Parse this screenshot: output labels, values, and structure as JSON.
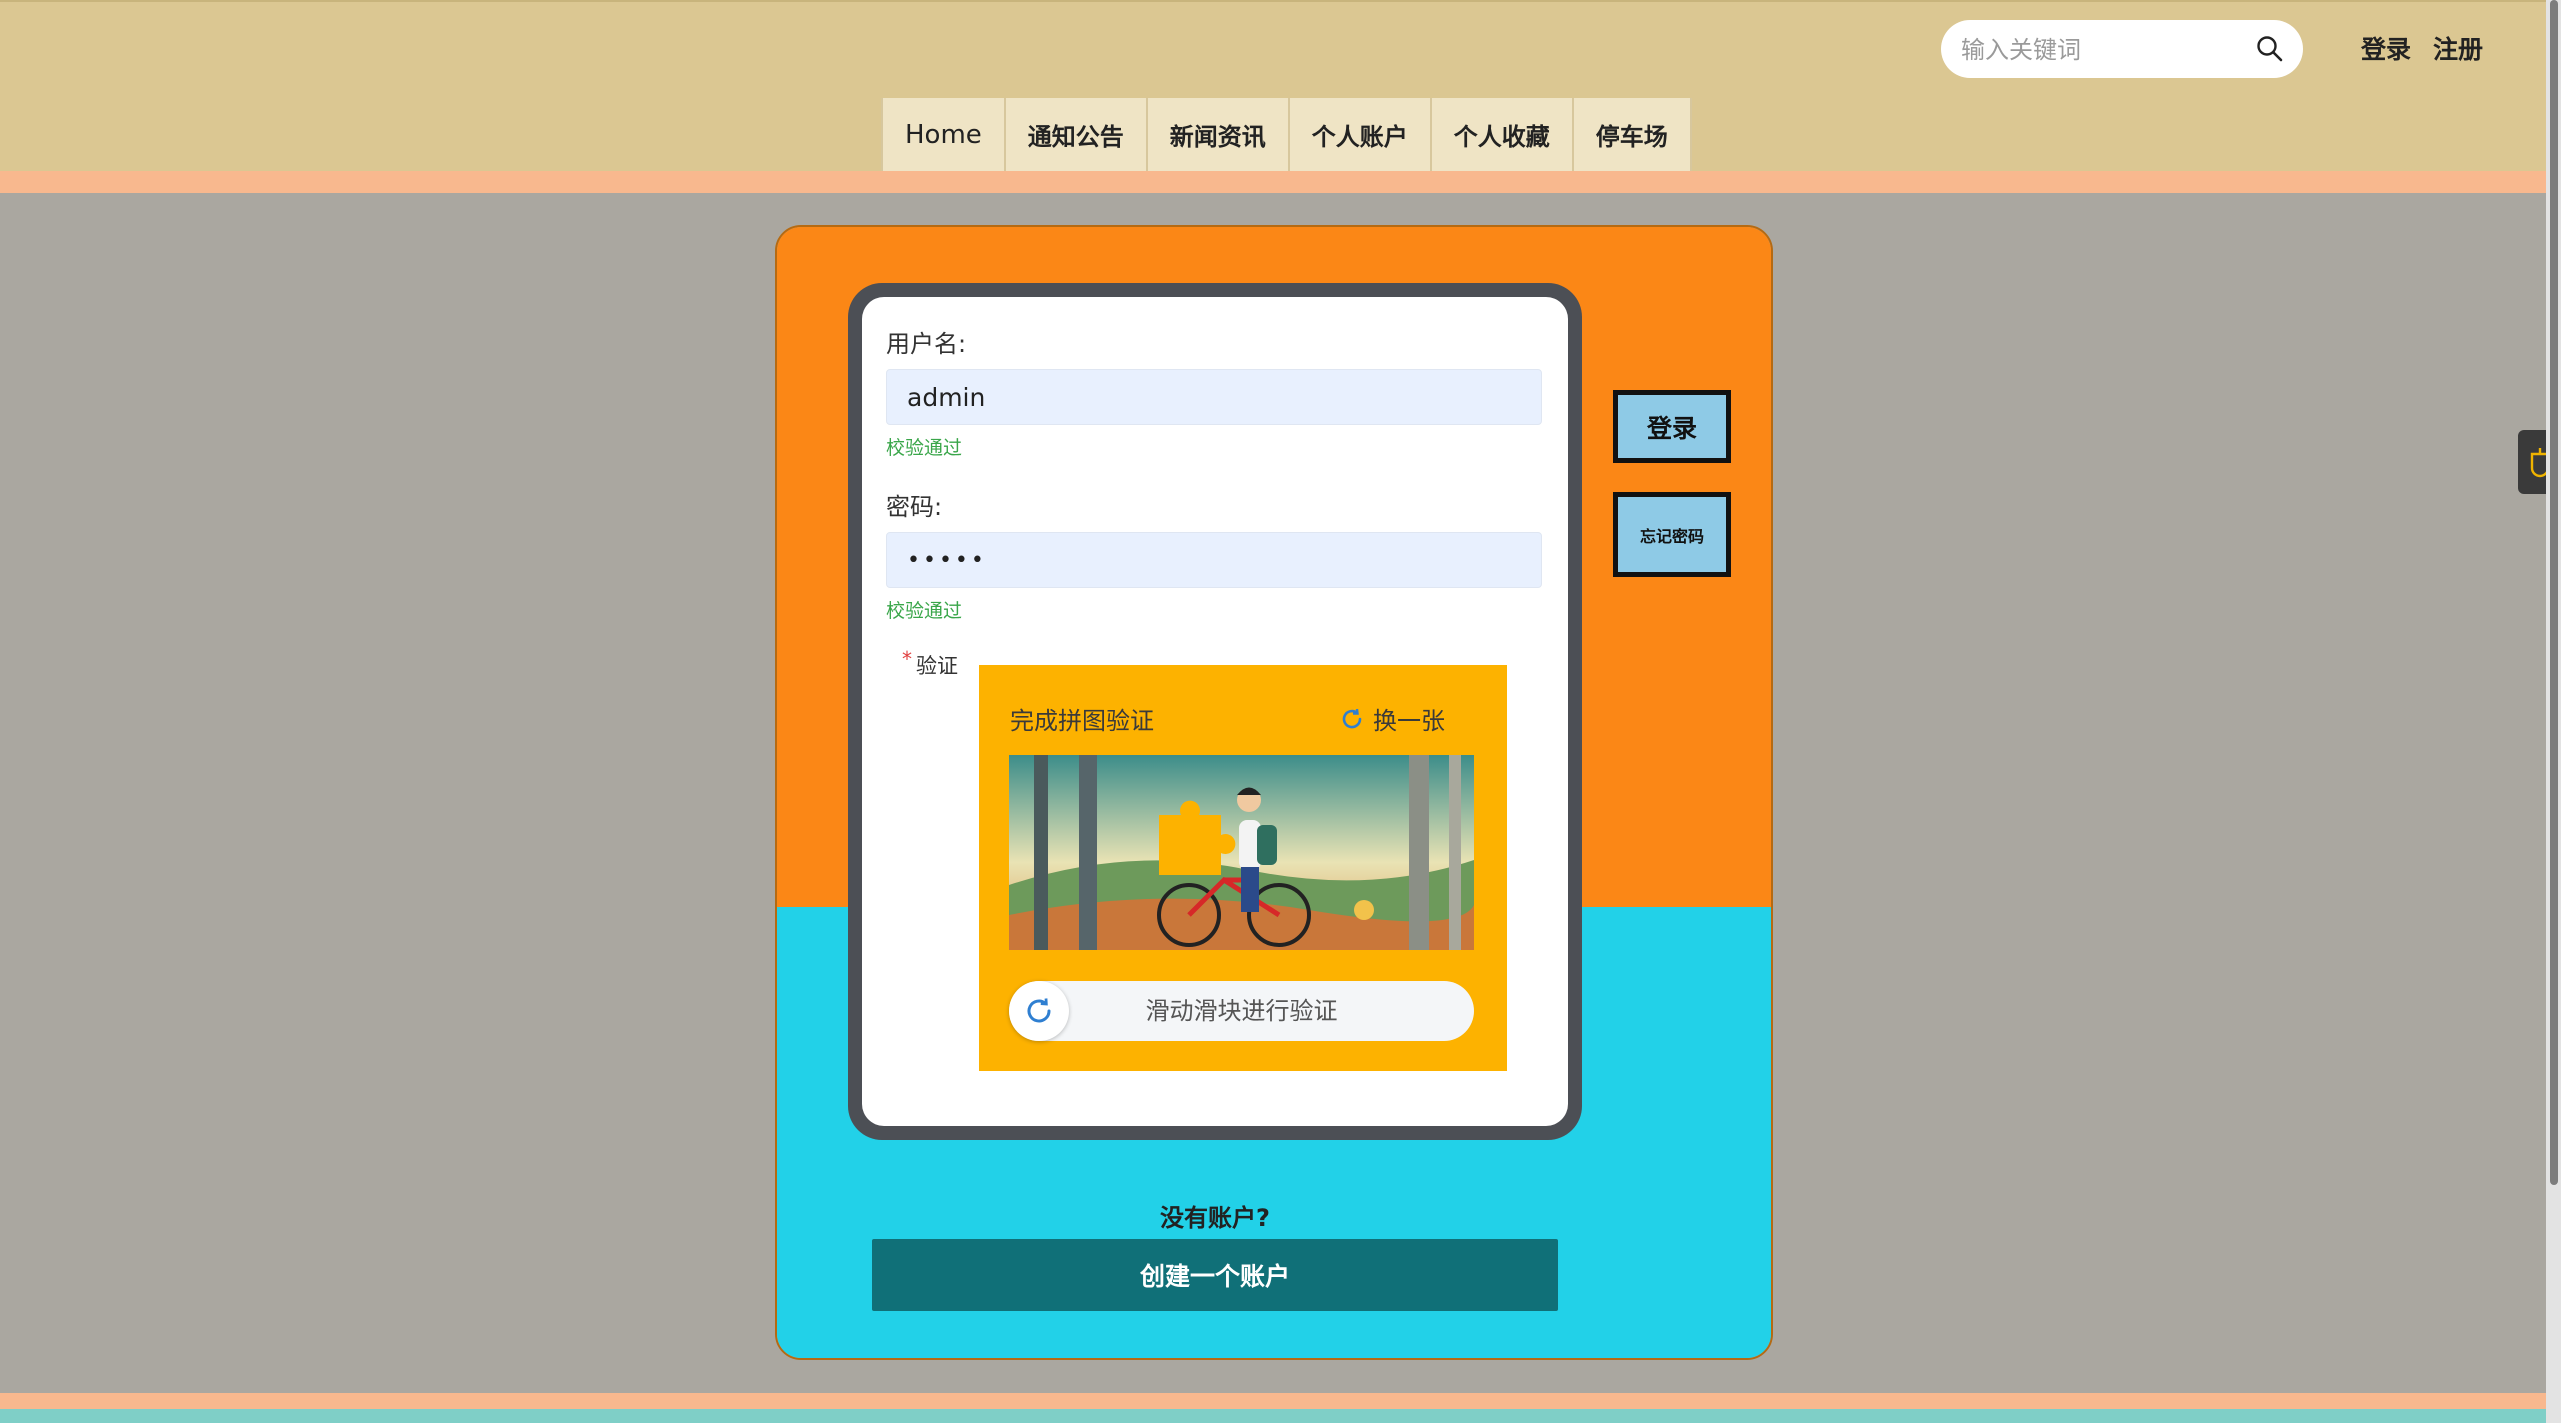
{
  "header": {
    "search_placeholder": "输入关键词",
    "login_link": "登录",
    "register_link": "注册"
  },
  "nav": {
    "items": [
      "Home",
      "通知公告",
      "新闻资讯",
      "个人账户",
      "个人收藏",
      "停车场"
    ]
  },
  "form": {
    "username_label": "用户名:",
    "username_value": "admin",
    "username_status": "校验通过",
    "password_label": "密码:",
    "password_value": "•••••",
    "password_status": "校验通过",
    "verify_required_mark": "*",
    "verify_label": "验证"
  },
  "captcha": {
    "title": "完成拼图验证",
    "refresh_label": "换一张",
    "slider_text": "滑动滑块进行验证"
  },
  "actions": {
    "login_button": "登录",
    "forgot_button": "忘记密码",
    "no_account_text": "没有账户?",
    "create_account_button": "创建一个账户"
  },
  "colors": {
    "header_bg": "#dbc792",
    "card_top": "#fb8716",
    "card_bottom": "#22d1e8",
    "captcha_bg": "#fdb200",
    "create_button": "#107078",
    "side_button": "#8ecae6",
    "status_ok": "#3aa64a"
  },
  "icons": {
    "search": "search-icon",
    "refresh": "refresh-icon",
    "slider": "slider-refresh-icon",
    "side_tab": "shield-icon"
  }
}
